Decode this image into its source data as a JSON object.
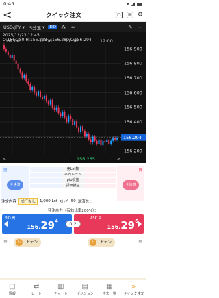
{
  "status": {
    "time": "0:45"
  },
  "header": {
    "title": "クイック注文"
  },
  "toolbar": {
    "pair": "USD/JPY",
    "timeframe": "5分足",
    "bid_tag": "BID"
  },
  "chart": {
    "datetime": "2025/12/23 12:45",
    "ohlc": "O:156.280 H:156.298 L:156.280 C:156.294",
    "time_labels": [
      "09:00",
      "10:00",
      "11:00",
      "12:00"
    ],
    "price_labels": [
      "156.900",
      "156.800",
      "156.700",
      "156.600",
      "156.500",
      "156.400",
      "156.300",
      "156.200"
    ],
    "current_price": "156.294",
    "low_marker": "156.235"
  },
  "chart_data": {
    "type": "candlestick",
    "series": [
      {
        "name": "USD/JPY 5分足",
        "color_up": "#1ea0ff",
        "color_down": "#e8395a"
      }
    ],
    "y_range": [
      156.18,
      156.93
    ],
    "x_ticks": [
      "09:00",
      "10:00",
      "11:00",
      "12:00"
    ],
    "last_close": 156.294,
    "low": 156.235
  },
  "panel": {
    "sell_label": "売",
    "buy_label": "買",
    "settle_sell": "全決済",
    "settle_buy": "全決済",
    "rows": [
      "売Lot数",
      "平均レート",
      "pip損益",
      "評価損益"
    ],
    "order_type_label": "注文内容",
    "order_type": "成行なし",
    "lot": "1,000 Lot",
    "slip": "ｽﾘｯﾌﾟ",
    "slip_value": "50",
    "settle": "決済なし"
  },
  "available": "発注余力（有効比率200%）：",
  "prices": {
    "bid_tag": "BID 売",
    "ask_tag": "ASK 買",
    "bid_small": "156.",
    "bid_big": "29",
    "bid_sup": "4",
    "ask_small": "156.",
    "ask_big": "29",
    "ask_sup": "6",
    "spread": "0.2"
  },
  "donten": {
    "left": "ドテン",
    "right": "ドテン"
  },
  "nav": [
    {
      "icon": "◫",
      "label": "情報"
    },
    {
      "icon": "⇄",
      "label": "レート"
    },
    {
      "icon": "▥",
      "label": "チャート"
    },
    {
      "icon": "▤",
      "label": "ポジション"
    },
    {
      "icon": "▦",
      "label": "注文一覧"
    },
    {
      "icon": "»",
      "label": "クイック注文"
    }
  ]
}
